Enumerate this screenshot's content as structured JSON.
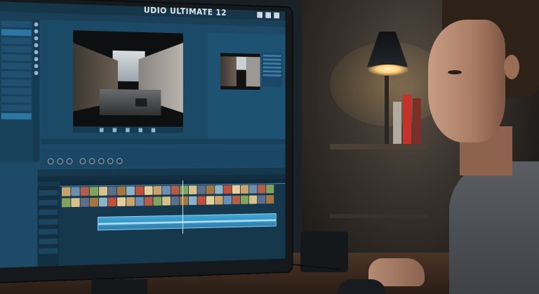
{
  "app": {
    "title_fragment": "UDIO ULTIMATE 12"
  },
  "colors": {
    "screen": "#1d4a66",
    "titlebar": "#153549",
    "accent": "#3fa6d6",
    "lamp": "#ffcf77"
  },
  "icons": [
    "minimize-icon",
    "maximize-icon",
    "close-icon",
    "play-icon",
    "pause-icon",
    "stop-icon"
  ]
}
